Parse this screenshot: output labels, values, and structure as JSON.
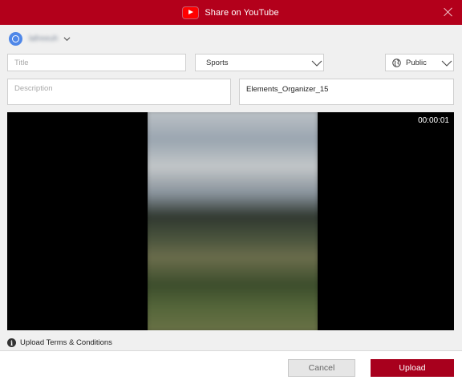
{
  "window": {
    "title": "Share on YouTube",
    "close_icon": "close-icon",
    "logo_icon": "youtube-logo-icon"
  },
  "account": {
    "name": "lafreeuh",
    "avatar_icon": "account-avatar-icon",
    "chevron_icon": "chevron-down-icon"
  },
  "form": {
    "title_placeholder": "Title",
    "title_value": "",
    "category": "Sports",
    "privacy": "Public",
    "privacy_icon": "globe-icon",
    "description_placeholder": "Description",
    "description_value": "",
    "tags": "Elements_Organizer_15"
  },
  "preview": {
    "timecode": "00:00:01"
  },
  "terms": {
    "label": "Upload Terms & Conditions",
    "icon": "info-icon"
  },
  "buttons": {
    "cancel": "Cancel",
    "upload": "Upload"
  },
  "colors": {
    "titlebar": "#b3001b",
    "upload_button": "#a8001d",
    "avatar": "#4f87e8"
  }
}
